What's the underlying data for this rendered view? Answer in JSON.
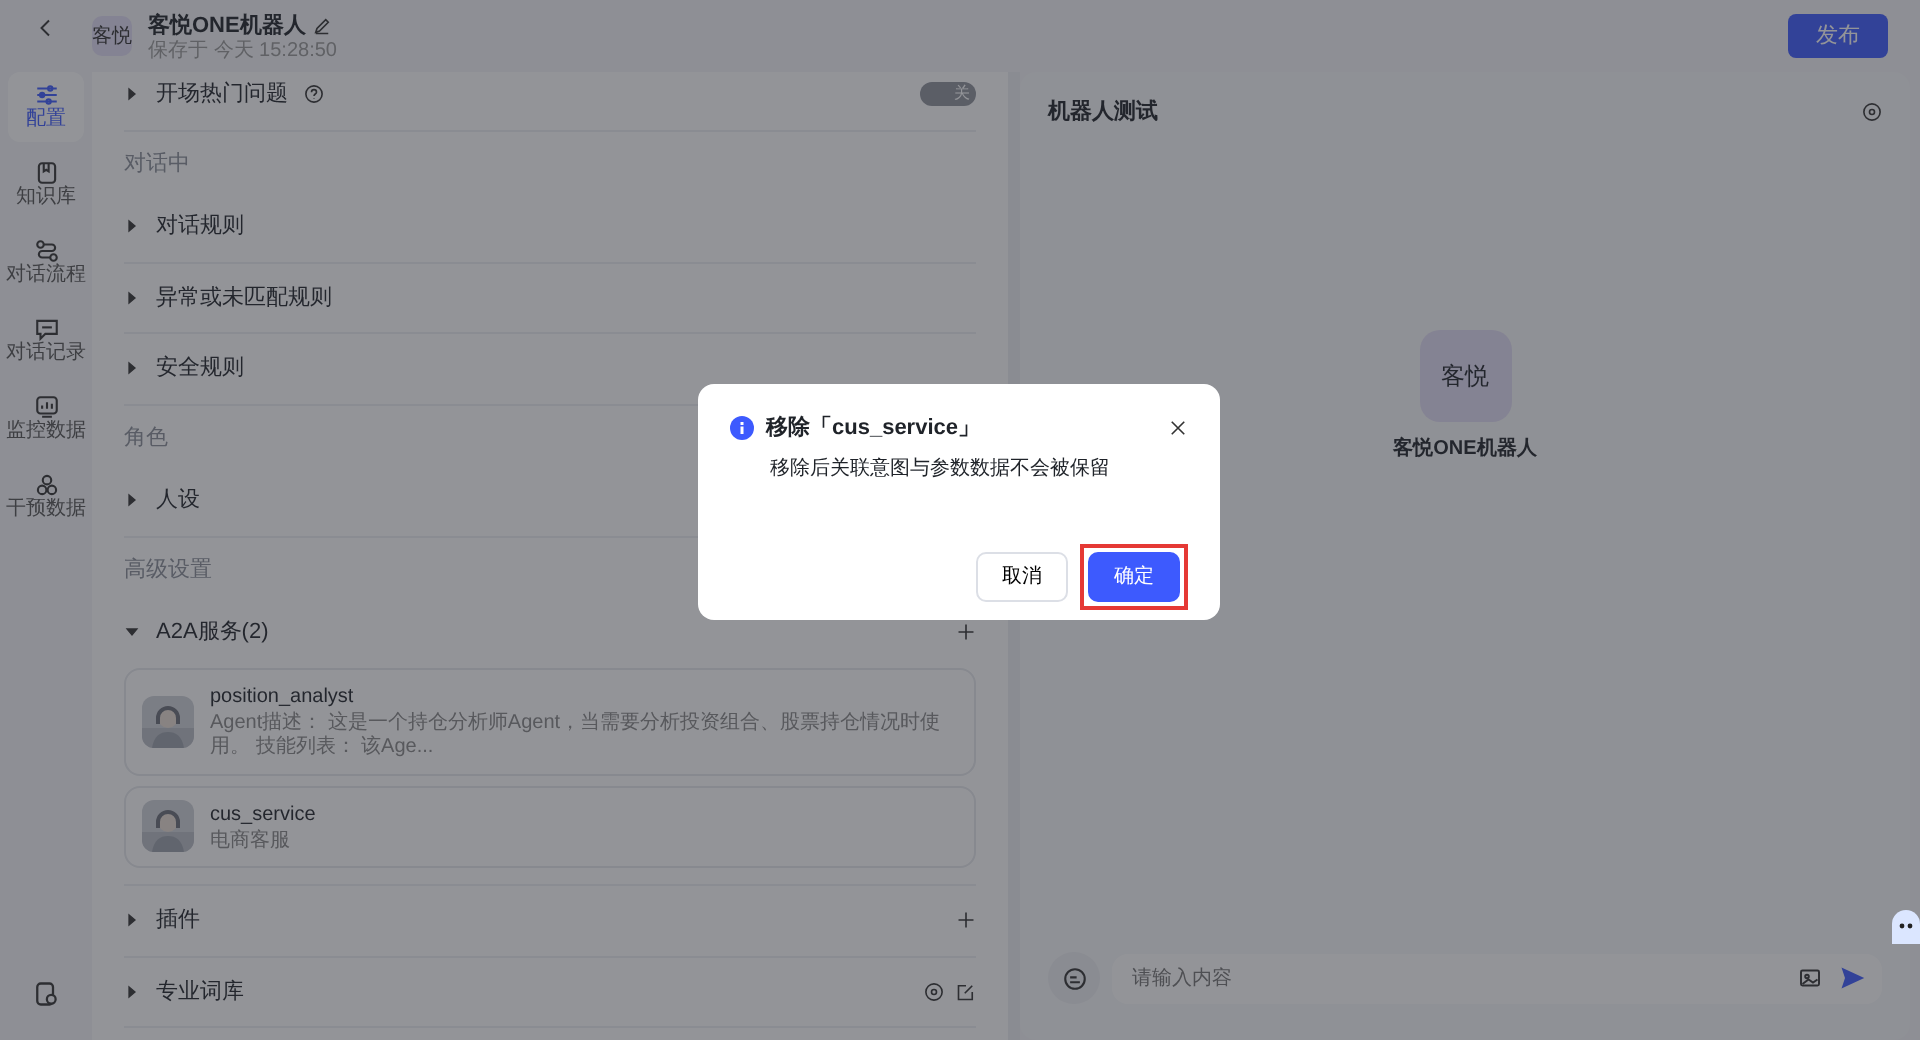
{
  "header": {
    "avatar": "客悦",
    "title": "客悦ONE机器人",
    "saved": "保存于 今天 15:28:50",
    "publish": "发布"
  },
  "nav": [
    {
      "kind": "sliders",
      "label": "配置",
      "selected": true
    },
    {
      "kind": "book",
      "label": "知识库",
      "selected": false
    },
    {
      "kind": "flow",
      "label": "对话流程",
      "selected": false
    },
    {
      "kind": "chat",
      "label": "对话记录",
      "selected": false
    },
    {
      "kind": "chart",
      "label": "监控数据",
      "selected": false
    },
    {
      "kind": "circles",
      "label": "干预数据",
      "selected": false
    }
  ],
  "config": {
    "top_row": {
      "label": "开场热门问题",
      "toggle": {
        "on": false,
        "label": "关"
      }
    },
    "sections": [
      {
        "title": "对话中",
        "items": [
          {
            "label": "对话规则",
            "expanded": false,
            "kind": "plain"
          },
          {
            "label": "异常或未匹配规则",
            "expanded": false,
            "kind": "plain"
          },
          {
            "label": "安全规则",
            "expanded": false,
            "kind": "plain"
          }
        ]
      },
      {
        "title": "角色",
        "items": [
          {
            "label": "人设",
            "expanded": false,
            "kind": "plain"
          }
        ]
      },
      {
        "title": "高级设置",
        "items": [
          {
            "label": "A2A服务(2)",
            "expanded": true,
            "kind": "add",
            "agents": [
              {
                "name": "position_analyst",
                "description": "Agent描述： 这是一个持仓分析师Agent，当需要分析投资组合、股票持仓情况时使用。 技能列表： 该Age..."
              },
              {
                "name": "cus_service",
                "description": "电商客服"
              }
            ]
          },
          {
            "label": "插件",
            "expanded": false,
            "kind": "add"
          },
          {
            "label": "专业词库",
            "expanded": false,
            "kind": "vocab"
          }
        ]
      }
    ]
  },
  "test_panel": {
    "title": "机器人测试",
    "bot_avatar": "客悦",
    "bot_name": "客悦ONE机器人",
    "input": {
      "placeholder": "请输入内容"
    }
  },
  "dialog": {
    "title": "移除「cus_service」",
    "message": "移除后关联意图与参数数据不会被保留",
    "buttons": [
      {
        "label": "取消",
        "kind": "cancel"
      },
      {
        "label": "确定",
        "kind": "confirm",
        "highlighted": true
      }
    ]
  }
}
